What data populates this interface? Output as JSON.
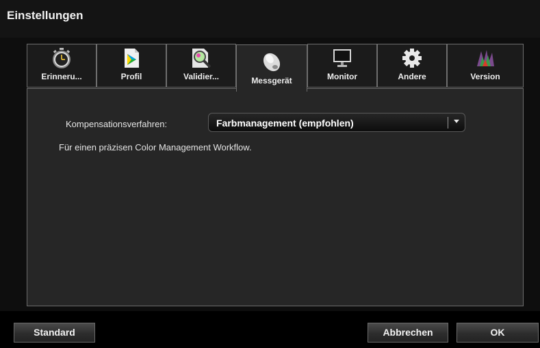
{
  "window": {
    "title": "Einstellungen"
  },
  "tabs": [
    {
      "label": "Erinneru...",
      "icon": "stopwatch-icon",
      "active": false
    },
    {
      "label": "Profil",
      "icon": "color-profile-document-icon",
      "active": false
    },
    {
      "label": "Validier...",
      "icon": "magnifier-validation-icon",
      "active": false
    },
    {
      "label": "Messgerät",
      "icon": "measuring-device-icon",
      "active": true
    },
    {
      "label": "Monitor",
      "icon": "monitor-icon",
      "active": false
    },
    {
      "label": "Andere",
      "icon": "gear-icon",
      "active": false
    },
    {
      "label": "Version",
      "icon": "color-splash-icon",
      "active": false
    }
  ],
  "settings": {
    "compensation_label": "Kompensationsverfahren:",
    "compensation_value": "Farbmanagement (empfohlen)",
    "description": "Für einen präzisen Color Management Workflow."
  },
  "footer": {
    "standard_label": "Standard",
    "cancel_label": "Abbrechen",
    "ok_label": "OK"
  }
}
